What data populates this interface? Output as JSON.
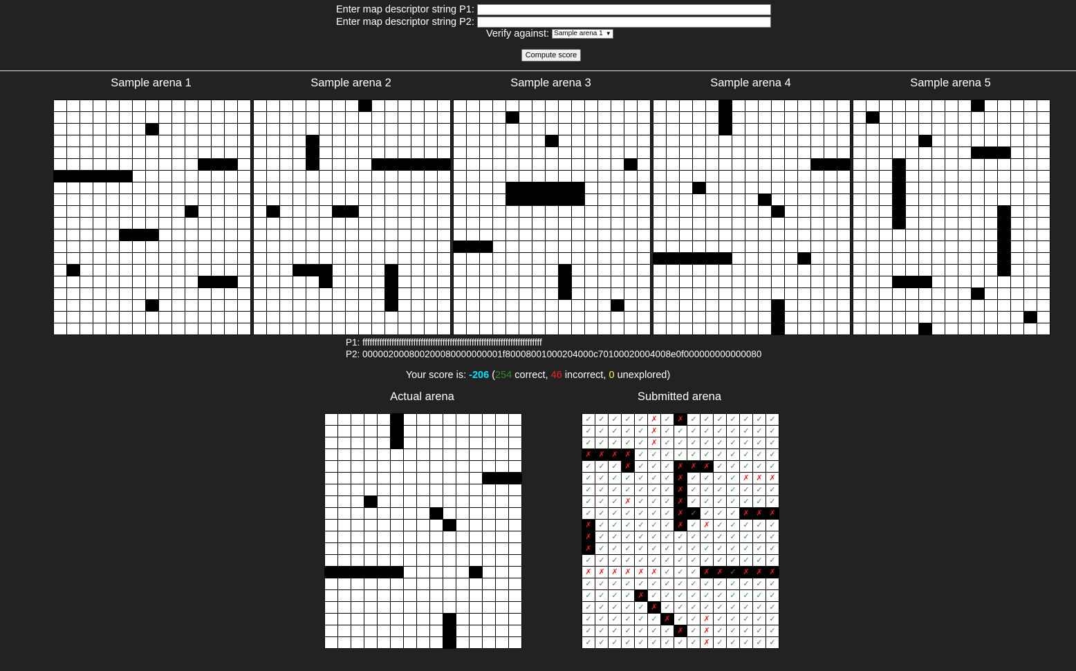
{
  "form": {
    "p1_label": "Enter map descriptor string P1:",
    "p2_label": "Enter map descriptor string P2:",
    "p1_value": "",
    "p2_value": "",
    "verify_label": "Verify against:",
    "verify_selected": "Sample arena 1",
    "compute_button": "Compute score"
  },
  "samples": [
    {
      "title": "Sample arena 1",
      "obstacles": [
        [
          2,
          7
        ],
        [
          5,
          11
        ],
        [
          5,
          12
        ],
        [
          5,
          13
        ],
        [
          6,
          0
        ],
        [
          6,
          1
        ],
        [
          6,
          2
        ],
        [
          6,
          3
        ],
        [
          6,
          4
        ],
        [
          6,
          5
        ],
        [
          9,
          10
        ],
        [
          11,
          5
        ],
        [
          11,
          6
        ],
        [
          11,
          7
        ],
        [
          14,
          1
        ],
        [
          15,
          11
        ],
        [
          15,
          12
        ],
        [
          15,
          13
        ],
        [
          17,
          7
        ]
      ]
    },
    {
      "title": "Sample arena 2",
      "obstacles": [
        [
          0,
          8
        ],
        [
          3,
          4
        ],
        [
          4,
          4
        ],
        [
          5,
          4
        ],
        [
          5,
          9
        ],
        [
          5,
          10
        ],
        [
          5,
          11
        ],
        [
          5,
          12
        ],
        [
          5,
          13
        ],
        [
          5,
          14
        ],
        [
          9,
          1
        ],
        [
          9,
          6
        ],
        [
          9,
          7
        ],
        [
          14,
          3
        ],
        [
          14,
          4
        ],
        [
          14,
          5
        ],
        [
          14,
          10
        ],
        [
          15,
          5
        ],
        [
          15,
          10
        ],
        [
          16,
          10
        ],
        [
          17,
          10
        ]
      ]
    },
    {
      "title": "Sample arena 3",
      "obstacles": [
        [
          1,
          4
        ],
        [
          3,
          7
        ],
        [
          5,
          13
        ],
        [
          7,
          4
        ],
        [
          7,
          5
        ],
        [
          7,
          6
        ],
        [
          7,
          7
        ],
        [
          7,
          8
        ],
        [
          7,
          9
        ],
        [
          8,
          4
        ],
        [
          8,
          5
        ],
        [
          8,
          6
        ],
        [
          8,
          7
        ],
        [
          8,
          8
        ],
        [
          8,
          9
        ],
        [
          12,
          0
        ],
        [
          12,
          1
        ],
        [
          12,
          2
        ],
        [
          14,
          8
        ],
        [
          15,
          8
        ],
        [
          16,
          8
        ],
        [
          17,
          12
        ]
      ]
    },
    {
      "title": "Sample arena 4",
      "obstacles": [
        [
          0,
          5
        ],
        [
          1,
          5
        ],
        [
          2,
          5
        ],
        [
          5,
          12
        ],
        [
          5,
          13
        ],
        [
          5,
          14
        ],
        [
          7,
          3
        ],
        [
          8,
          8
        ],
        [
          9,
          9
        ],
        [
          13,
          0
        ],
        [
          13,
          1
        ],
        [
          13,
          2
        ],
        [
          13,
          3
        ],
        [
          13,
          4
        ],
        [
          13,
          5
        ],
        [
          13,
          11
        ],
        [
          17,
          9
        ],
        [
          18,
          9
        ],
        [
          19,
          9
        ]
      ]
    },
    {
      "title": "Sample arena 5",
      "obstacles": [
        [
          0,
          9
        ],
        [
          1,
          1
        ],
        [
          3,
          5
        ],
        [
          4,
          9
        ],
        [
          4,
          10
        ],
        [
          4,
          11
        ],
        [
          5,
          3
        ],
        [
          6,
          3
        ],
        [
          7,
          3
        ],
        [
          8,
          3
        ],
        [
          9,
          3
        ],
        [
          9,
          11
        ],
        [
          10,
          3
        ],
        [
          10,
          11
        ],
        [
          11,
          11
        ],
        [
          12,
          11
        ],
        [
          13,
          11
        ],
        [
          14,
          11
        ],
        [
          15,
          3
        ],
        [
          15,
          4
        ],
        [
          15,
          5
        ],
        [
          16,
          9
        ],
        [
          18,
          13
        ],
        [
          19,
          5
        ]
      ]
    }
  ],
  "strings": {
    "p1_label": "P1:",
    "p1_value": "ffffffffffffffffffffffffffffffffffffffffffffffffffffffffffffffffffffffffff",
    "p2_label": "P2:",
    "p2_value": "000002000800200080000000001f80008001000204000c70100020004008e0f000000000000080"
  },
  "score": {
    "prefix": "Your score is: ",
    "value": "-206",
    "paren_open": " (",
    "correct": "254",
    "correct_label": " correct, ",
    "incorrect": "46",
    "incorrect_label": " incorrect, ",
    "unexplored": "0",
    "unexplored_label": " unexplored)"
  },
  "actual": {
    "title": "Actual arena",
    "obstacles": [
      [
        0,
        5
      ],
      [
        1,
        5
      ],
      [
        2,
        5
      ],
      [
        5,
        12
      ],
      [
        5,
        13
      ],
      [
        5,
        14
      ],
      [
        7,
        3
      ],
      [
        8,
        8
      ],
      [
        9,
        9
      ],
      [
        13,
        0
      ],
      [
        13,
        1
      ],
      [
        13,
        2
      ],
      [
        13,
        3
      ],
      [
        13,
        4
      ],
      [
        13,
        5
      ],
      [
        13,
        11
      ],
      [
        17,
        9
      ],
      [
        18,
        9
      ],
      [
        19,
        9
      ]
    ]
  },
  "submitted": {
    "title": "Submitted arena",
    "correct_mark": "✓",
    "incorrect_mark": "✗",
    "incorrect": [
      [
        0,
        5
      ],
      [
        0,
        7
      ],
      [
        1,
        5
      ],
      [
        2,
        5
      ],
      [
        3,
        0
      ],
      [
        3,
        1
      ],
      [
        3,
        2
      ],
      [
        3,
        3
      ],
      [
        4,
        3
      ],
      [
        4,
        7
      ],
      [
        4,
        8
      ],
      [
        4,
        9
      ],
      [
        5,
        7
      ],
      [
        5,
        12
      ],
      [
        5,
        13
      ],
      [
        5,
        14
      ],
      [
        6,
        7
      ],
      [
        7,
        3
      ],
      [
        7,
        7
      ],
      [
        8,
        7
      ],
      [
        8,
        12
      ],
      [
        8,
        13
      ],
      [
        8,
        14
      ],
      [
        9,
        0
      ],
      [
        9,
        7
      ],
      [
        9,
        9
      ],
      [
        10,
        0
      ],
      [
        11,
        0
      ],
      [
        13,
        0
      ],
      [
        13,
        1
      ],
      [
        13,
        2
      ],
      [
        13,
        3
      ],
      [
        13,
        4
      ],
      [
        13,
        5
      ],
      [
        13,
        9
      ],
      [
        13,
        10
      ],
      [
        13,
        12
      ],
      [
        13,
        13
      ],
      [
        13,
        14
      ],
      [
        15,
        4
      ],
      [
        16,
        5
      ],
      [
        17,
        6
      ],
      [
        17,
        9
      ],
      [
        18,
        7
      ],
      [
        18,
        9
      ],
      [
        19,
        9
      ]
    ],
    "black": [
      [
        0,
        7
      ],
      [
        3,
        0
      ],
      [
        3,
        1
      ],
      [
        3,
        2
      ],
      [
        3,
        3
      ],
      [
        4,
        3
      ],
      [
        4,
        7
      ],
      [
        4,
        8
      ],
      [
        4,
        9
      ],
      [
        5,
        7
      ],
      [
        6,
        7
      ],
      [
        7,
        7
      ],
      [
        8,
        7
      ],
      [
        8,
        8
      ],
      [
        8,
        12
      ],
      [
        8,
        13
      ],
      [
        8,
        14
      ],
      [
        9,
        0
      ],
      [
        9,
        7
      ],
      [
        10,
        0
      ],
      [
        11,
        0
      ],
      [
        13,
        9
      ],
      [
        13,
        10
      ],
      [
        13,
        11
      ],
      [
        13,
        12
      ],
      [
        13,
        13
      ],
      [
        13,
        14
      ],
      [
        15,
        4
      ],
      [
        16,
        5
      ],
      [
        17,
        6
      ],
      [
        18,
        7
      ]
    ]
  },
  "colors": {
    "background": "#222222",
    "score": "#00e5ff",
    "correct": "#2e8b2e",
    "incorrect": "#ff2020",
    "unexplored": "#ffff33"
  }
}
